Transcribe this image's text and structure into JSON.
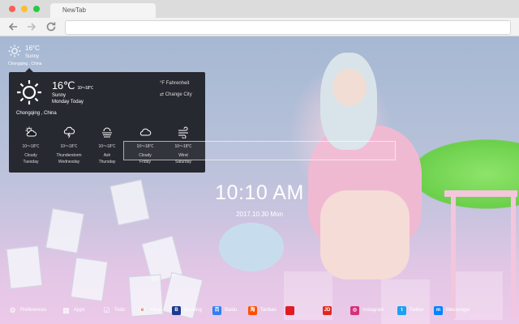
{
  "browser": {
    "tab_title": "NewTab",
    "back_icon": "arrow-left-icon",
    "forward_icon": "arrow-right-icon",
    "reload_icon": "reload-icon"
  },
  "mini_weather": {
    "icon": "sun-icon",
    "temp": "16°C",
    "condition": "Sunny",
    "location": "Chongqing , China"
  },
  "weather_panel": {
    "icon": "sun-icon",
    "temp": "16℃",
    "temp_range": "10～18℃",
    "condition": "Sunny",
    "day": "Monday Today",
    "unit_toggle": "°F Fahrenheit",
    "change_city": "⇄ Change City",
    "location": "Chongqing , China",
    "forecast": [
      {
        "icon": "cloudy-day-icon",
        "range": "10～18℃",
        "condition": "Cloudy",
        "day": "Tuesday"
      },
      {
        "icon": "thunderstorm-icon",
        "range": "10～18℃",
        "condition": "Thunderstorm",
        "day": "Wednesday"
      },
      {
        "icon": "ash-icon",
        "range": "10～18℃",
        "condition": "Ash",
        "day": "Thursday"
      },
      {
        "icon": "cloud-icon",
        "range": "10～18℃",
        "condition": "Cloudy",
        "day": "Friday"
      },
      {
        "icon": "wind-icon",
        "range": "10～18℃",
        "condition": "Wind",
        "day": "Saturday"
      }
    ]
  },
  "clock": {
    "time": "10:10 AM",
    "date": "2017.10.30 Mon"
  },
  "dock": [
    {
      "label": "Preferences",
      "icon": "gear-icon",
      "color": "#ffffff",
      "glyph": "⚙"
    },
    {
      "label": "Apps",
      "icon": "apps-grid-icon",
      "color": "#ffffff",
      "glyph": "▦"
    },
    {
      "label": "Todo",
      "icon": "todo-icon",
      "color": "#ffffff",
      "glyph": "☑"
    },
    {
      "label": "eBay",
      "icon": "ebay-icon",
      "color": "#f2f2f2",
      "glyph": "e"
    },
    {
      "label": "Booking",
      "icon": "booking-icon",
      "color": "#1b3a8f",
      "glyph": "B"
    },
    {
      "label": "Baidu",
      "icon": "baidu-icon",
      "color": "#2f7ff3",
      "glyph": "百"
    },
    {
      "label": "Taobao",
      "icon": "taobao-icon",
      "color": "#ff5000",
      "glyph": "淘"
    },
    {
      "label": "",
      "icon": "red-app-icon",
      "color": "#e21b22",
      "glyph": ""
    },
    {
      "label": "",
      "icon": "jd-icon",
      "color": "#e0281e",
      "glyph": "JD"
    },
    {
      "label": "Instagram",
      "icon": "instagram-icon",
      "color": "#d6307a",
      "glyph": "◎"
    },
    {
      "label": "Twitter",
      "icon": "twitter-icon",
      "color": "#1da1f2",
      "glyph": "t"
    },
    {
      "label": "Messenger",
      "icon": "messenger-icon",
      "color": "#0084ff",
      "glyph": "m"
    }
  ]
}
